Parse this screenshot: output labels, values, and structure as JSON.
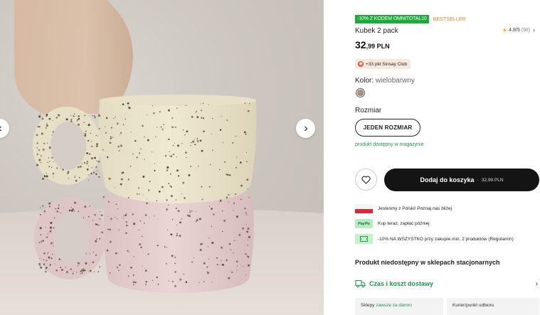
{
  "gallery": {
    "prev_icon": "chevron-left-icon",
    "next_icon": "chevron-right-icon"
  },
  "product": {
    "promo_tag": "-10% Z KODEM OMNITOTAL10",
    "bestseller_tag": "BESTSELLER",
    "title": "Kubek 2 pack",
    "rating": "4,8/5",
    "rating_count": "(58)",
    "price_main": "32",
    "price_rest": ",99 PLN",
    "club_text": "+33 pkt Sinsay Club",
    "color_label": "Kolor:",
    "color_value": "wielobarwny",
    "size_label": "Rozmiar",
    "size_option": "JEDEN ROZMIAR",
    "availability": "produkt dostępny w magazynie",
    "cart_label": "Dodaj do koszyka",
    "cart_sep": "·",
    "cart_price": "32,99 PLN"
  },
  "info": {
    "poland": "Jesteśmy z Polski! Poznaj nas bliżej",
    "paypo_logo": "PayPo",
    "paypo": "Kup teraz, zapłać później",
    "discount": "-10% NA WSZYSTKO przy zakupie min. 2 produktów (Regulamin)"
  },
  "stores": {
    "unavailable": "Produkt niedostępny w sklepach stacjonarnych"
  },
  "delivery": {
    "label": "Czas i koszt dostawy",
    "shops_prefix": "Sklepy",
    "shops_free": "zawsze za darmo",
    "courier": "Kurier/punkt odbioru"
  },
  "colors": {
    "promo_green": "#1ea93b",
    "bestseller_orange": "#e9832a",
    "accent_green": "#1c9a45",
    "cart_black": "#141414"
  }
}
